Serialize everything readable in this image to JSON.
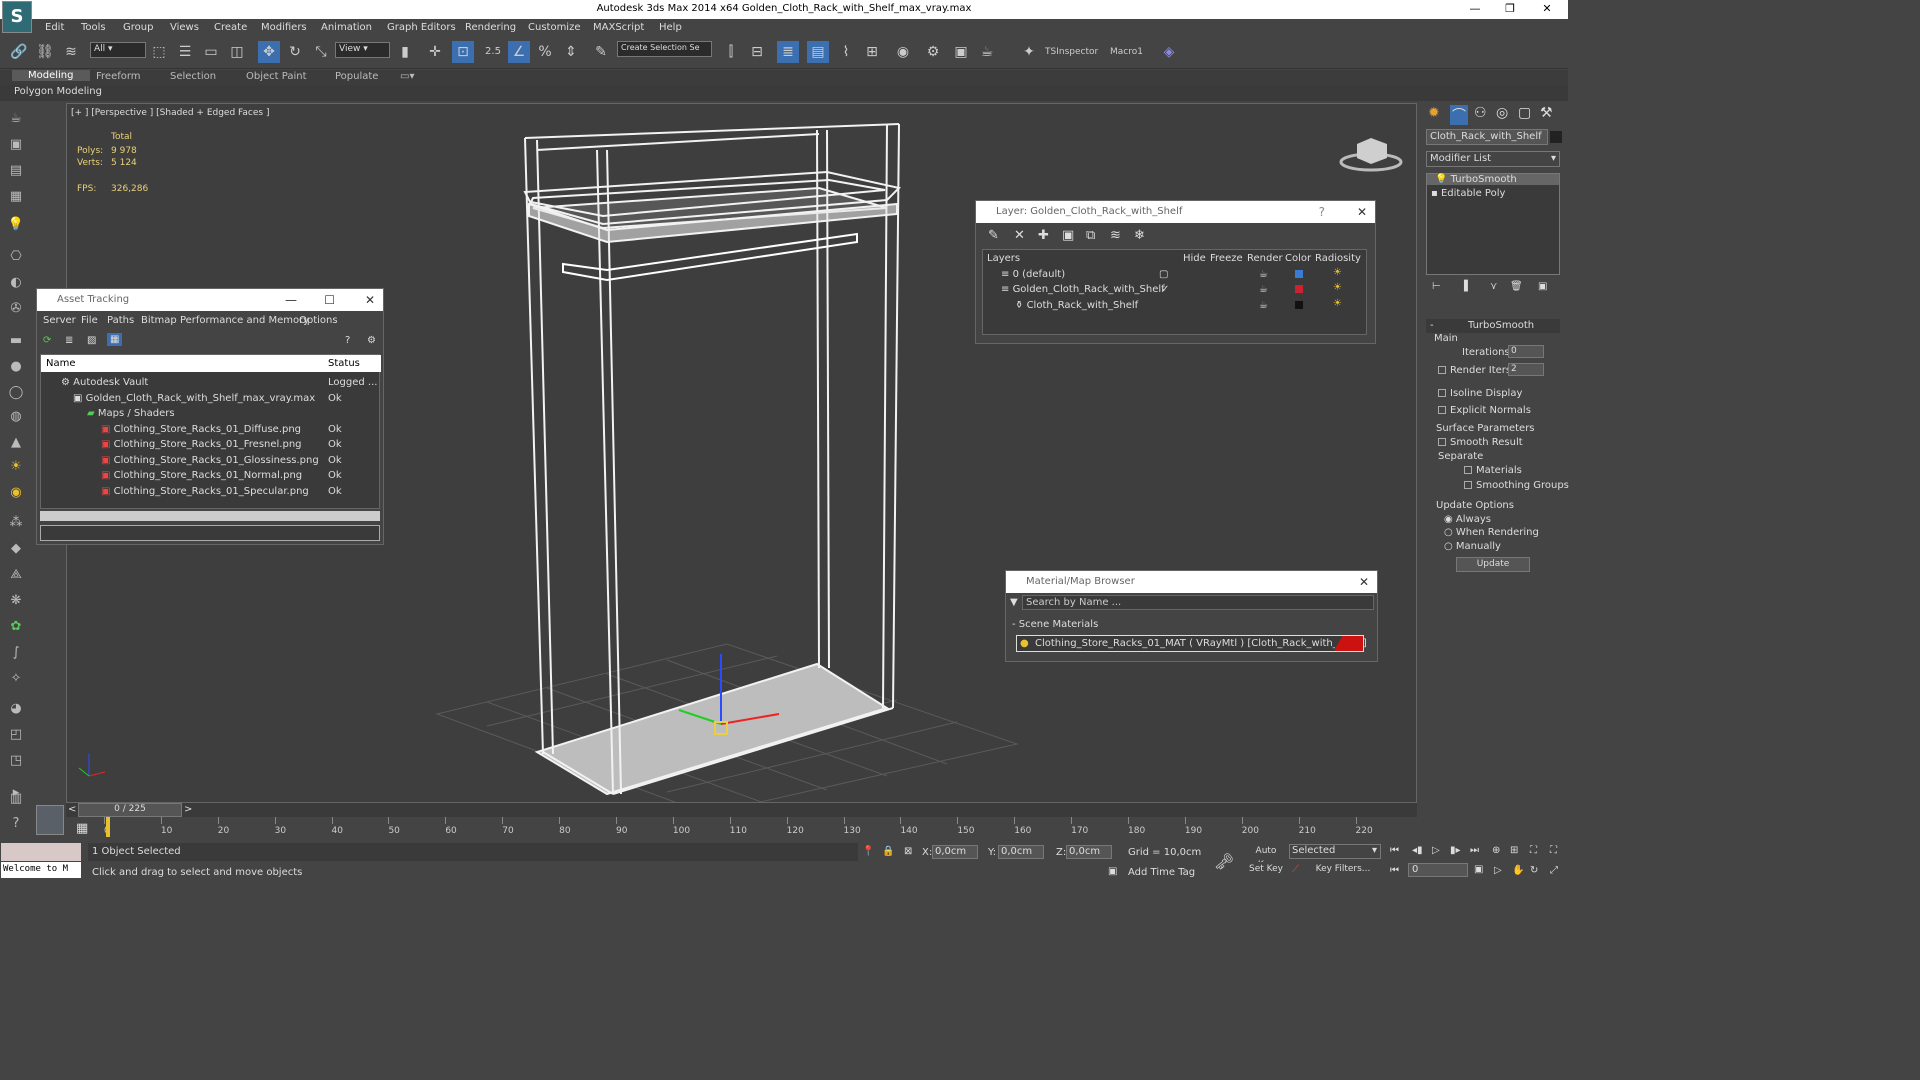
{
  "app": {
    "title": "Autodesk 3ds Max  2014 x64     Golden_Cloth_Rack_with_Shelf_max_vray.max"
  },
  "menu": [
    "Edit",
    "Tools",
    "Group",
    "Views",
    "Create",
    "Modifiers",
    "Animation",
    "Graph Editors",
    "Rendering",
    "Customize",
    "MAXScript",
    "Help"
  ],
  "toolbar": {
    "filter": "All",
    "refcoord": "View",
    "snap_value": "2.5",
    "selection_set": "Create Selection Se",
    "tsinspector": "TSInspector",
    "macro": "Macro1"
  },
  "ribbon": {
    "tabs": [
      "Modeling",
      "Freeform",
      "Selection",
      "Object Paint",
      "Populate"
    ],
    "sub": "Polygon Modeling"
  },
  "viewport": {
    "label": "[+ ] [Perspective ] [Shaded + Edged Faces ]",
    "total": "Total",
    "polys_label": "Polys:",
    "polys": "9 978",
    "verts_label": "Verts:",
    "verts": "5 124",
    "fps_label": "FPS:",
    "fps": "326,286"
  },
  "asset": {
    "title": "Asset Tracking",
    "menu": [
      "Server",
      "File",
      "Paths",
      "Bitmap Performance and Memory",
      "Options"
    ],
    "col_name": "Name",
    "col_status": "Status",
    "rows": [
      {
        "name": "Autodesk Vault",
        "status": "Logged ..."
      },
      {
        "name": "Golden_Cloth_Rack_with_Shelf_max_vray.max",
        "status": "Ok"
      },
      {
        "name": "Maps / Shaders",
        "status": ""
      },
      {
        "name": "Clothing_Store_Racks_01_Diffuse.png",
        "status": "Ok"
      },
      {
        "name": "Clothing_Store_Racks_01_Fresnel.png",
        "status": "Ok"
      },
      {
        "name": "Clothing_Store_Racks_01_Glossiness.png",
        "status": "Ok"
      },
      {
        "name": "Clothing_Store_Racks_01_Normal.png",
        "status": "Ok"
      },
      {
        "name": "Clothing_Store_Racks_01_Specular.png",
        "status": "Ok"
      }
    ]
  },
  "layer": {
    "title": "Layer: Golden_Cloth_Rack_with_Shelf",
    "help": "?",
    "cols": [
      "Layers",
      "Hide",
      "Freeze",
      "Render",
      "Color",
      "Radiosity"
    ],
    "rows": [
      {
        "name": "0 (default)",
        "color": "#3a7bd5"
      },
      {
        "name": "Golden_Cloth_Rack_with_Shelf",
        "color": "#cc2233"
      },
      {
        "name": "Cloth_Rack_with_Shelf",
        "color": "#111111"
      }
    ]
  },
  "matbrowser": {
    "title": "Material/Map Browser",
    "search": "Search by Name ...",
    "group": "- Scene Materials",
    "material": "Clothing_Store_Racks_01_MAT  ( VRayMtl ) [Cloth_Rack_with_Shelf]"
  },
  "cmd": {
    "object": "Cloth_Rack_with_Shelf",
    "modlist": "Modifier List",
    "stack": [
      "TurboSmooth",
      "Editable Poly"
    ],
    "rollout": "TurboSmooth",
    "main": "Main",
    "iterations_label": "Iterations:",
    "iterations": "0",
    "render_iters_label": "Render Iters:",
    "render_iters": "2",
    "isoline": "Isoline Display",
    "explicit": "Explicit Normals",
    "surface": "Surface Parameters",
    "smooth": "Smooth Result",
    "separate": "Separate",
    "materials": "Materials",
    "smoothing": "Smoothing Groups",
    "update_opts": "Update Options",
    "always": "Always",
    "when": "When Rendering",
    "manually": "Manually",
    "update": "Update"
  },
  "time": {
    "frame": "0 / 225",
    "ticks": [
      "0",
      "10",
      "20",
      "30",
      "40",
      "50",
      "60",
      "70",
      "80",
      "90",
      "100",
      "110",
      "120",
      "130",
      "140",
      "150",
      "160",
      "170",
      "180",
      "190",
      "200",
      "210",
      "220"
    ]
  },
  "status": {
    "welcome": "Welcome to M",
    "selected": "1 Object Selected",
    "hint": "Click and drag to select and move objects",
    "x_label": "X:",
    "x": "0,0cm",
    "y_label": "Y:",
    "y": "0,0cm",
    "z_label": "Z:",
    "z": "0,0cm",
    "grid": "Grid = 10,0cm",
    "addtime": "Add Time Tag",
    "autokey": "Auto Key",
    "selected_set": "Selected",
    "setkey": "Set Key",
    "keyfilters": "Key Filters...",
    "frame_field": "0"
  }
}
